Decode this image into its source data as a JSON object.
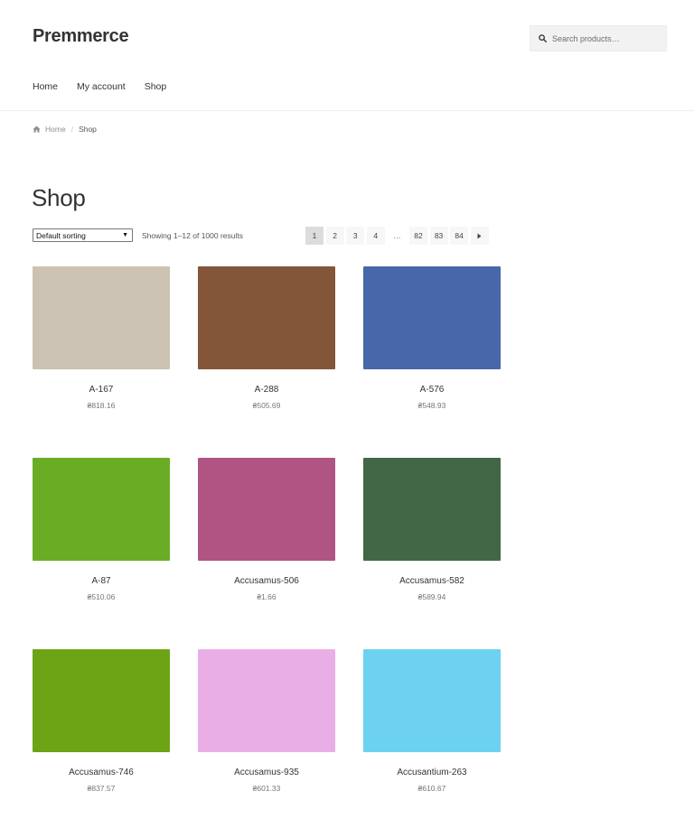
{
  "site": {
    "title": "Premmerce"
  },
  "search": {
    "placeholder": "Search products…"
  },
  "nav": {
    "items": [
      {
        "label": "Home"
      },
      {
        "label": "My account"
      },
      {
        "label": "Shop"
      }
    ]
  },
  "breadcrumb": {
    "home": "Home",
    "separator": "/",
    "current": "Shop"
  },
  "page": {
    "title": "Shop"
  },
  "toolbar": {
    "sort_selected": "Default sorting",
    "result_count": "Showing 1–12 of 1000 results"
  },
  "pagination": {
    "pages": [
      "1",
      "2",
      "3",
      "4",
      "…",
      "82",
      "83",
      "84"
    ],
    "current": "1",
    "next_icon": "triangle-right-icon"
  },
  "products": [
    {
      "name": "A-167",
      "price": "₴818.16",
      "color": "#cbc2b3"
    },
    {
      "name": "A-288",
      "price": "₴505.69",
      "color": "#835639"
    },
    {
      "name": "A-576",
      "price": "₴548.93",
      "color": "#4867ab"
    },
    {
      "name": "A-87",
      "price": "₴510.06",
      "color": "#6aad25"
    },
    {
      "name": "Accusamus-506",
      "price": "₴1.66",
      "color": "#b05484"
    },
    {
      "name": "Accusamus-582",
      "price": "₴589.94",
      "color": "#426746"
    },
    {
      "name": "Accusamus-746",
      "price": "₴837.57",
      "color": "#6ca416"
    },
    {
      "name": "Accusamus-935",
      "price": "₴601.33",
      "color": "#eaaee6"
    },
    {
      "name": "Accusantium-263",
      "price": "₴610.67",
      "color": "#6cd2f0"
    }
  ],
  "icons": {
    "search": "search-icon",
    "home": "home-icon"
  }
}
